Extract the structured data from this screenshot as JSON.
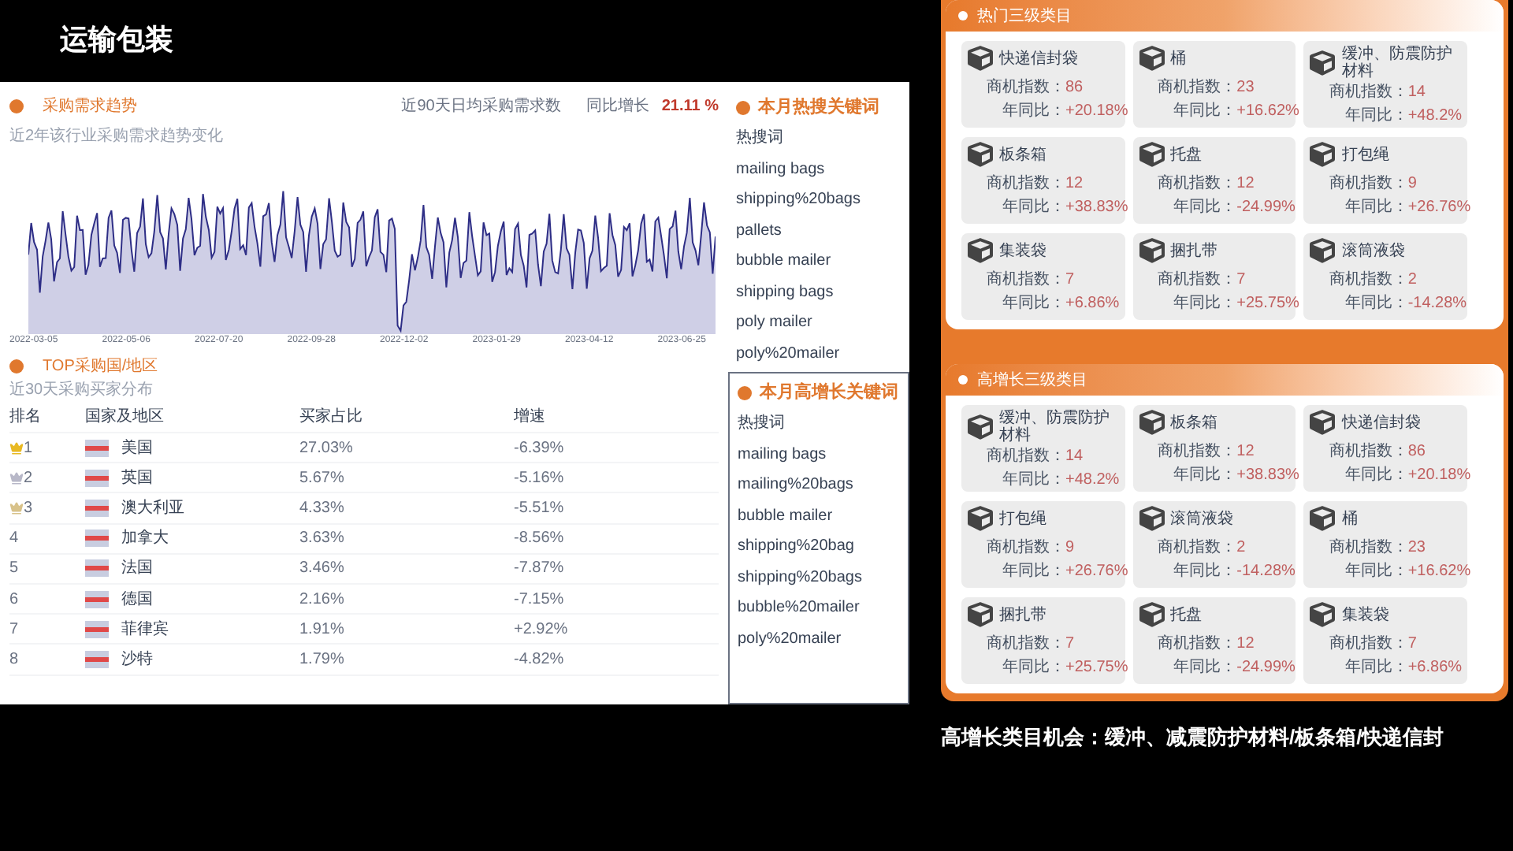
{
  "title": "运输包装",
  "trend": {
    "title": "采购需求趋势",
    "stat_label": "近90天日均采购需求数",
    "growth_label": "同比增长",
    "growth_value": "21.11 %",
    "subtitle": "近2年该行业采购需求趋势变化",
    "x_labels": [
      "2022-03-05",
      "2022-05-06",
      "2022-07-20",
      "2022-09-28",
      "2022-12-02",
      "2023-01-29",
      "2023-04-12",
      "2023-06-25"
    ]
  },
  "top_countries": {
    "title": "TOP采购国/地区",
    "subtitle": "近30天采购买家分布",
    "columns": [
      "排名",
      "国家及地区",
      "买家占比",
      "增速"
    ],
    "rows": [
      {
        "rank": "1",
        "color": "#e8b923",
        "country": "美国",
        "share": "27.03%",
        "growth": "-6.39%"
      },
      {
        "rank": "2",
        "color": "#b8b8c8",
        "country": "英国",
        "share": "5.67%",
        "growth": "-5.16%"
      },
      {
        "rank": "3",
        "color": "#d8c28a",
        "country": "澳大利亚",
        "share": "4.33%",
        "growth": "-5.51%"
      },
      {
        "rank": "4",
        "country": "加拿大",
        "share": "3.63%",
        "growth": "-8.56%"
      },
      {
        "rank": "5",
        "country": "法国",
        "share": "3.46%",
        "growth": "-7.87%"
      },
      {
        "rank": "6",
        "country": "德国",
        "share": "2.16%",
        "growth": "-7.15%"
      },
      {
        "rank": "7",
        "country": "菲律宾",
        "share": "1.91%",
        "growth": "+2.92%"
      },
      {
        "rank": "8",
        "country": "沙特",
        "share": "1.79%",
        "growth": "-4.82%"
      }
    ]
  },
  "hot_keywords": {
    "title": "本月热搜关键词",
    "items": [
      "热搜词",
      "mailing bags",
      "shipping%20bags",
      "pallets",
      "bubble mailer",
      "shipping bags",
      "poly mailer",
      "poly%20mailer"
    ]
  },
  "rising_keywords": {
    "title": "本月高增长关键词",
    "items": [
      "热搜词",
      "mailing bags",
      "mailing%20bags",
      "bubble mailer",
      "shipping%20bag",
      "shipping%20bags",
      "bubble%20mailer",
      "poly%20mailer"
    ]
  },
  "hot_categories": {
    "title": "热门三级类目",
    "cards": [
      {
        "name": "快递信封袋",
        "index_label": "商机指数：",
        "index": "86",
        "yoy_label": "年同比：",
        "yoy": "+20.18%"
      },
      {
        "name": "桶",
        "index_label": "商机指数：",
        "index": "23",
        "yoy_label": "年同比：",
        "yoy": "+16.62%"
      },
      {
        "name": "缓冲、防震防护材料",
        "index_label": "商机指数：",
        "index": "14",
        "yoy_label": "年同比：",
        "yoy": "+48.2%"
      },
      {
        "name": "板条箱",
        "index_label": "商机指数：",
        "index": "12",
        "yoy_label": "年同比：",
        "yoy": "+38.83%"
      },
      {
        "name": "托盘",
        "index_label": "商机指数：",
        "index": "12",
        "yoy_label": "年同比：",
        "yoy": "-24.99%"
      },
      {
        "name": "打包绳",
        "index_label": "商机指数：",
        "index": "9",
        "yoy_label": "年同比：",
        "yoy": "+26.76%"
      },
      {
        "name": "集装袋",
        "index_label": "商机指数：",
        "index": "7",
        "yoy_label": "年同比：",
        "yoy": "+6.86%"
      },
      {
        "name": "捆扎带",
        "index_label": "商机指数：",
        "index": "7",
        "yoy_label": "年同比：",
        "yoy": "+25.75%"
      },
      {
        "name": "滚筒液袋",
        "index_label": "商机指数：",
        "index": "2",
        "yoy_label": "年同比：",
        "yoy": "-14.28%"
      }
    ]
  },
  "rising_categories": {
    "title": "高增长三级类目",
    "cards": [
      {
        "name": "缓冲、防震防护材料",
        "index_label": "商机指数：",
        "index": "14",
        "yoy_label": "年同比：",
        "yoy": "+48.2%"
      },
      {
        "name": "板条箱",
        "index_label": "商机指数：",
        "index": "12",
        "yoy_label": "年同比：",
        "yoy": "+38.83%"
      },
      {
        "name": "快递信封袋",
        "index_label": "商机指数：",
        "index": "86",
        "yoy_label": "年同比：",
        "yoy": "+20.18%"
      },
      {
        "name": "打包绳",
        "index_label": "商机指数：",
        "index": "9",
        "yoy_label": "年同比：",
        "yoy": "+26.76%"
      },
      {
        "name": "滚筒液袋",
        "index_label": "商机指数：",
        "index": "2",
        "yoy_label": "年同比：",
        "yoy": "-14.28%"
      },
      {
        "name": "桶",
        "index_label": "商机指数：",
        "index": "23",
        "yoy_label": "年同比：",
        "yoy": "+16.62%"
      },
      {
        "name": "捆扎带",
        "index_label": "商机指数：",
        "index": "7",
        "yoy_label": "年同比：",
        "yoy": "+25.75%"
      },
      {
        "name": "托盘",
        "index_label": "商机指数：",
        "index": "12",
        "yoy_label": "年同比：",
        "yoy": "-24.99%"
      },
      {
        "name": "集装袋",
        "index_label": "商机指数：",
        "index": "7",
        "yoy_label": "年同比：",
        "yoy": "+6.86%"
      }
    ]
  },
  "conclusion": "高增长类目机会：缓冲、减震防护材料/板条箱/快递信封"
}
